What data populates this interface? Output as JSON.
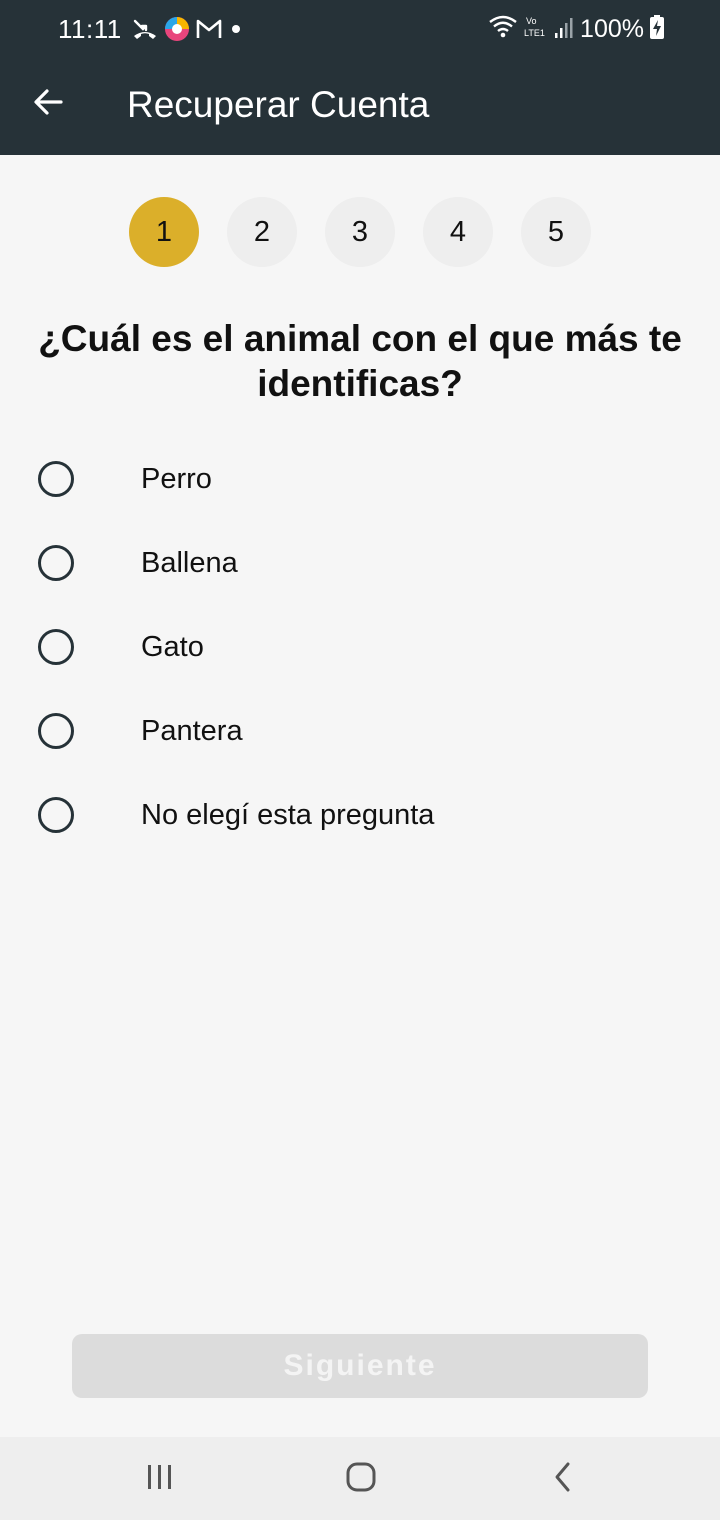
{
  "status_bar": {
    "time": "11:11",
    "battery": "100%",
    "icons": [
      "missed-call-icon",
      "browser-app-icon",
      "gmail-icon",
      "notification-dot-icon",
      "wifi-icon",
      "volte-icon",
      "signal-icon",
      "battery-charging-icon"
    ]
  },
  "app_bar": {
    "title": "Recuperar Cuenta",
    "back_icon": "arrow-left-icon",
    "background": "#263238"
  },
  "steps": {
    "items": [
      "1",
      "2",
      "3",
      "4",
      "5"
    ],
    "active_index": 0,
    "active_color": "#dbaf2a"
  },
  "question": "¿Cuál es el animal con el que más te identificas?",
  "options": [
    "Perro",
    "Ballena",
    "Gato",
    "Pantera",
    "No elegí esta pregunta"
  ],
  "next_button": {
    "label": "Siguiente",
    "enabled": false
  },
  "nav_bar": {
    "icons": [
      "recent-apps-icon",
      "home-icon",
      "back-icon"
    ]
  }
}
